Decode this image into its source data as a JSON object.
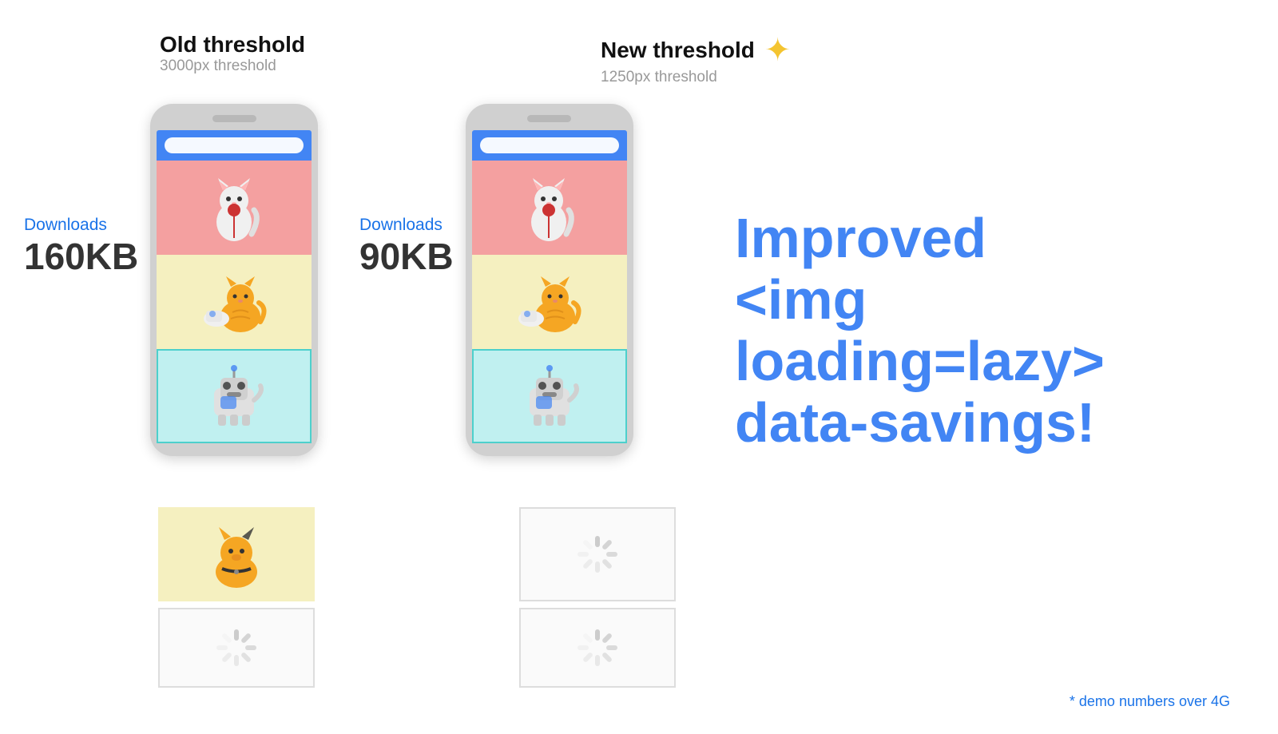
{
  "old_threshold": {
    "title": "Old threshold",
    "subtitle": "3000px threshold",
    "downloads_label": "Downloads",
    "downloads_size": "160KB"
  },
  "new_threshold": {
    "title": "New threshold",
    "subtitle": "1250px threshold",
    "downloads_label": "Downloads",
    "downloads_size": "90KB"
  },
  "right_text": {
    "line1": "Improved",
    "line2": "<img loading=lazy>",
    "line3": "data-savings!"
  },
  "demo_note": "* demo numbers over 4G",
  "colors": {
    "blue": "#4285f4",
    "text_dark": "#111111",
    "text_gray": "#888888",
    "downloads_blue": "#1a73e8"
  }
}
